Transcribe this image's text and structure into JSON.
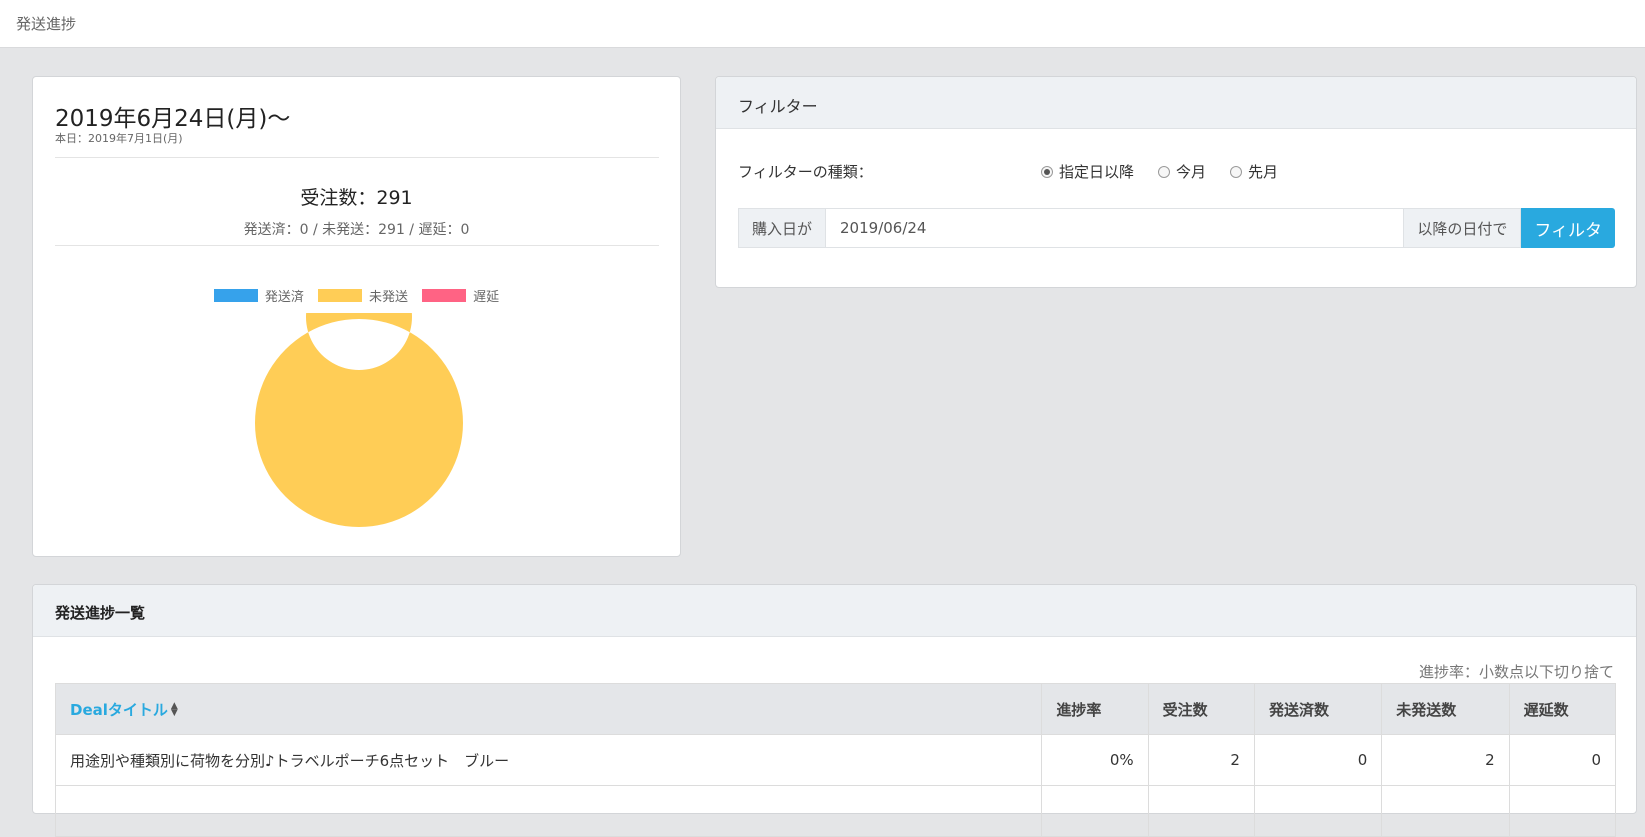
{
  "page": {
    "title": "発送進捗"
  },
  "summary": {
    "period_title": "2019年6月24日(月)〜",
    "today_label": "本日：2019年7月1日(月)",
    "order_count": "受注数：291",
    "breakdown": "発送済：0 / 未発送：291 / 遅延：0"
  },
  "chart_data": {
    "type": "pie",
    "categories": [
      "発送済",
      "未発送",
      "遅延"
    ],
    "values": [
      0,
      291,
      0
    ],
    "colors": [
      "#36a2eb",
      "#ffcd56",
      "#ff6384"
    ],
    "legend": "top"
  },
  "filter": {
    "title": "フィルター",
    "type_label": "フィルターの種類：",
    "options": [
      {
        "label": "指定日以降",
        "checked": true
      },
      {
        "label": "今月",
        "checked": false
      },
      {
        "label": "先月",
        "checked": false
      }
    ],
    "prefix": "購入日が",
    "date_value": "2019/06/24",
    "suffix": "以降の日付で",
    "button_label": "フィルタ"
  },
  "list": {
    "title": "発送進捗一覧",
    "note": "進捗率：小数点以下切り捨て",
    "columns": [
      "Dealタイトル",
      "進捗率",
      "受注数",
      "発送済数",
      "未発送数",
      "遅延数"
    ],
    "rows": [
      [
        "用途別や種類別に荷物を分別♪トラベルポーチ6点セット　ブルー",
        "0%",
        "2",
        "0",
        "2",
        "0"
      ],
      [
        "",
        "",
        "",
        "",
        "",
        ""
      ]
    ]
  },
  "colors": {
    "accent": "#29a9df",
    "header_bg": "#eef1f4",
    "page_bg": "#e4e5e7"
  }
}
